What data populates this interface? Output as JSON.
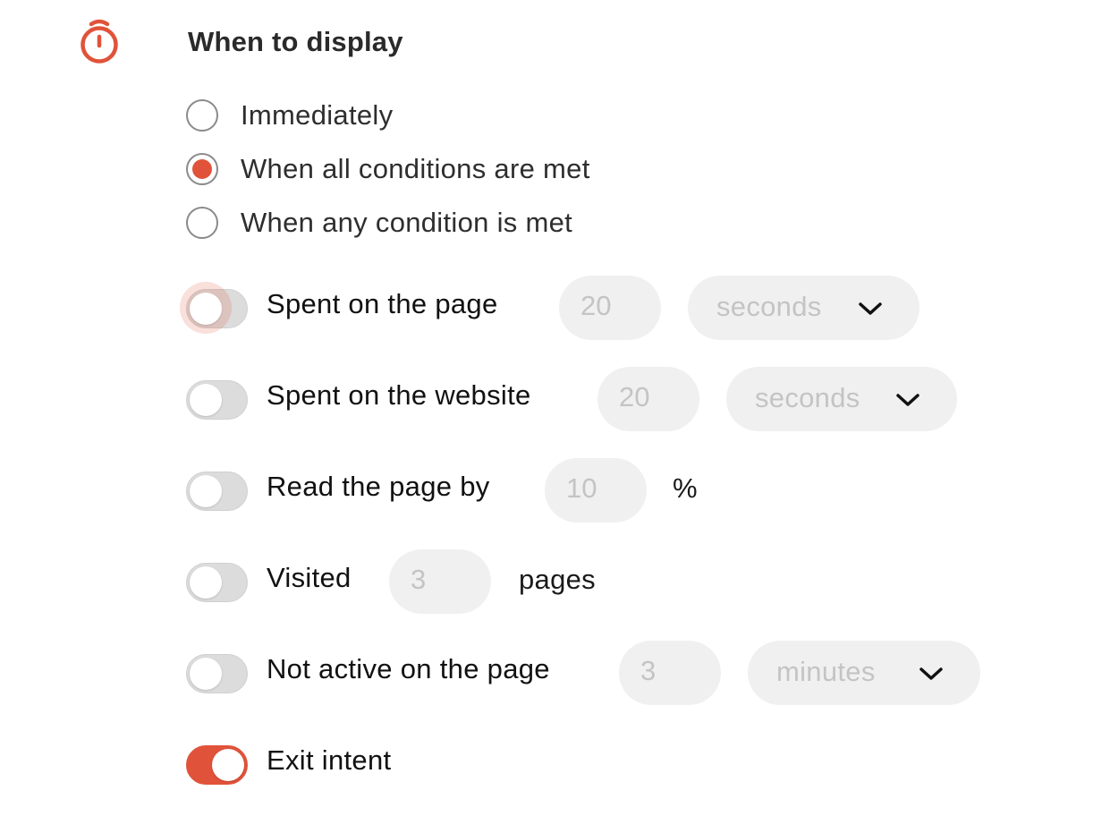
{
  "section": {
    "icon": "stopwatch-icon",
    "title": "When to display"
  },
  "display_mode": {
    "selected": "When all conditions are met",
    "options": [
      {
        "label": "Immediately",
        "checked": false
      },
      {
        "label": "When all conditions are met",
        "checked": true
      },
      {
        "label": "When any condition is met",
        "checked": false
      }
    ]
  },
  "conditions": {
    "spent_on_page": {
      "label": "Spent on the page",
      "enabled": false,
      "value": "20",
      "unit": "seconds"
    },
    "spent_on_website": {
      "label": "Spent on the website",
      "enabled": false,
      "value": "20",
      "unit": "seconds"
    },
    "read_page": {
      "label": "Read the page by",
      "enabled": false,
      "value": "10",
      "suffix": "%"
    },
    "visited": {
      "label": "Visited",
      "enabled": false,
      "value": "3",
      "suffix": "pages"
    },
    "not_active": {
      "label": "Not active on the page",
      "enabled": false,
      "value": "3",
      "unit": "minutes"
    },
    "exit_intent": {
      "label": "Exit intent",
      "enabled": true
    }
  },
  "colors": {
    "accent": "#e0533a",
    "toggle_off": "#dcdcdc",
    "input_bg": "#f0f0f0",
    "disabled_text": "#c4c4c4"
  }
}
